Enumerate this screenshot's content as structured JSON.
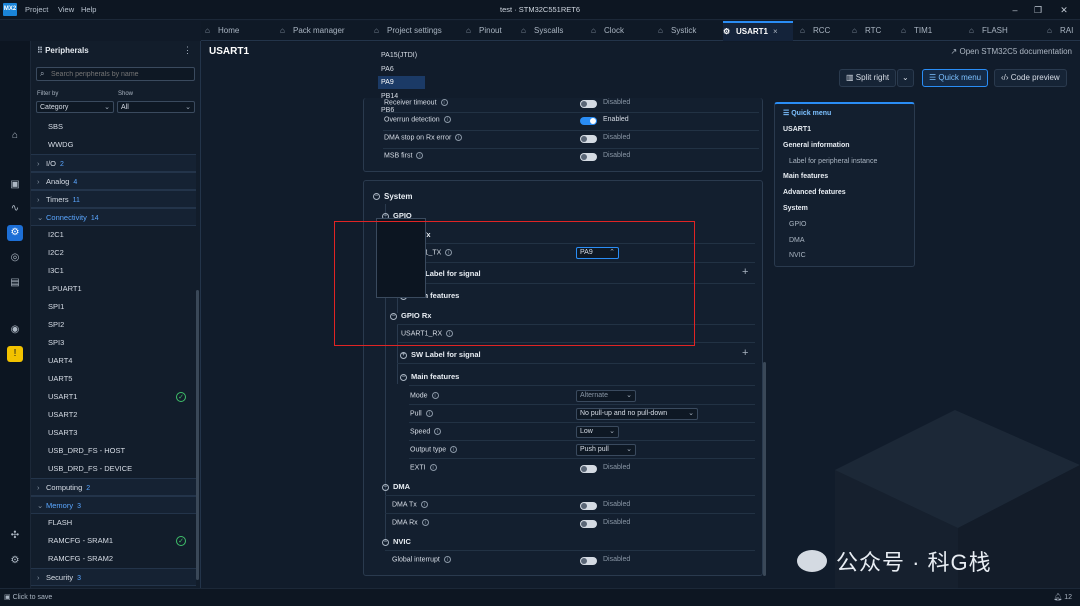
{
  "titlebar": {
    "logo": "MX2",
    "menus": [
      "Project",
      "View",
      "Help"
    ],
    "title": "test  ·  STM32C551RET6"
  },
  "tabs": [
    {
      "label": "Home",
      "icon": "home-icon"
    },
    {
      "label": "Pack manager",
      "icon": "box-icon"
    },
    {
      "label": "Project settings",
      "icon": "file-icon"
    },
    {
      "label": "Pinout",
      "icon": "chip-icon"
    },
    {
      "label": "Syscalls",
      "icon": "code-icon"
    },
    {
      "label": "Clock",
      "icon": "chart-icon"
    },
    {
      "label": "Systick",
      "icon": "chip-icon"
    },
    {
      "label": "USART1",
      "icon": "chip-icon",
      "active": true,
      "close": "×"
    },
    {
      "label": "RCC",
      "icon": "chip-icon"
    },
    {
      "label": "RTC",
      "icon": "chip-icon"
    },
    {
      "label": "TIM1",
      "icon": "chip-icon"
    },
    {
      "label": "FLASH",
      "icon": "chip-icon"
    },
    {
      "label": "RAI",
      "icon": "chip-icon"
    }
  ],
  "sidebar": {
    "title": "Peripherals",
    "search_placeholder": "Search peripherals by name",
    "filter_by_label": "Filter by",
    "filter_by_value": "Category",
    "show_label": "Show",
    "show_value": "All",
    "items": [
      {
        "type": "item",
        "label": "SBS"
      },
      {
        "type": "item",
        "label": "WWDG"
      },
      {
        "type": "group",
        "label": "I/O",
        "count": "2"
      },
      {
        "type": "group",
        "label": "Analog",
        "count": "4"
      },
      {
        "type": "group",
        "label": "Timers",
        "count": "11"
      },
      {
        "type": "group",
        "label": "Connectivity",
        "count": "14",
        "open": true
      },
      {
        "type": "item",
        "label": "I2C1"
      },
      {
        "type": "item",
        "label": "I2C2"
      },
      {
        "type": "item",
        "label": "I3C1"
      },
      {
        "type": "item",
        "label": "LPUART1"
      },
      {
        "type": "item",
        "label": "SPI1"
      },
      {
        "type": "item",
        "label": "SPI2"
      },
      {
        "type": "item",
        "label": "SPI3"
      },
      {
        "type": "item",
        "label": "UART4"
      },
      {
        "type": "item",
        "label": "UART5"
      },
      {
        "type": "item",
        "label": "USART1",
        "checked": true
      },
      {
        "type": "item",
        "label": "USART2"
      },
      {
        "type": "item",
        "label": "USART3"
      },
      {
        "type": "item",
        "label": "USB_DRD_FS - HOST"
      },
      {
        "type": "item",
        "label": "USB_DRD_FS - DEVICE"
      },
      {
        "type": "group",
        "label": "Computing",
        "count": "2"
      },
      {
        "type": "group",
        "label": "Memory",
        "count": "3",
        "open": true
      },
      {
        "type": "item",
        "label": "FLASH"
      },
      {
        "type": "item",
        "label": "RAMCFG - SRAM1",
        "checked": true
      },
      {
        "type": "item",
        "label": "RAMCFG - SRAM2"
      },
      {
        "type": "group",
        "label": "Security",
        "count": "3"
      }
    ]
  },
  "main": {
    "title": "USART1",
    "doc_link": "Open STM32C5 documentation",
    "split_btn": "Split right",
    "quick_btn": "Quick menu",
    "code_btn": "Code preview"
  },
  "top_settings": [
    {
      "label": "Receiver timeout",
      "state": "Disabled",
      "on": false
    },
    {
      "label": "Overrun detection",
      "state": "Enabled",
      "on": true
    },
    {
      "label": "DMA stop on Rx error",
      "state": "Disabled",
      "on": false
    },
    {
      "label": "MSB first",
      "state": "Disabled",
      "on": false
    }
  ],
  "system": {
    "title": "System",
    "gpio": "GPIO",
    "gpio_tx": "GPIO Tx",
    "tx_label": "USART1_TX",
    "tx_value": "PA9",
    "sw_label": "SW Label for signal",
    "main_features": "Main features",
    "gpio_rx": "GPIO Rx",
    "rx_label": "USART1_RX",
    "sw_label2": "SW Label for signal",
    "main_features2": "Main features",
    "pin_options": [
      "PA15(JTDI)",
      "PA6",
      "PA9",
      "PB14",
      "PB6"
    ],
    "mode_label": "Mode",
    "mode_value": "Alternate",
    "pull_label": "Pull",
    "pull_value": "No pull-up and no pull-down",
    "speed_label": "Speed",
    "speed_value": "Low",
    "otype_label": "Output type",
    "otype_value": "Push pull",
    "exti_label": "EXTI",
    "exti_state": "Disabled",
    "dma": "DMA",
    "dmatx_label": "DMA Tx",
    "dmatx_state": "Disabled",
    "dmarx_label": "DMA Rx",
    "dmarx_state": "Disabled",
    "nvic": "NVIC",
    "gi_label": "Global interrupt",
    "gi_state": "Disabled"
  },
  "quickmenu": {
    "title": "Quick menu",
    "items": [
      {
        "label": "USART1",
        "style": "b"
      },
      {
        "label": "General information",
        "style": "b"
      },
      {
        "label": "Label for peripheral instance",
        "style": "i"
      },
      {
        "label": "Main features",
        "style": "b"
      },
      {
        "label": "Advanced features",
        "style": "b"
      },
      {
        "label": "System",
        "style": "b"
      },
      {
        "label": "GPIO",
        "style": "i"
      },
      {
        "label": "DMA",
        "style": "i"
      },
      {
        "label": "NVIC",
        "style": "i"
      }
    ]
  },
  "statusbar": {
    "left": "Click to save",
    "right": "12"
  },
  "watermark": "公众号 · 科G栈"
}
